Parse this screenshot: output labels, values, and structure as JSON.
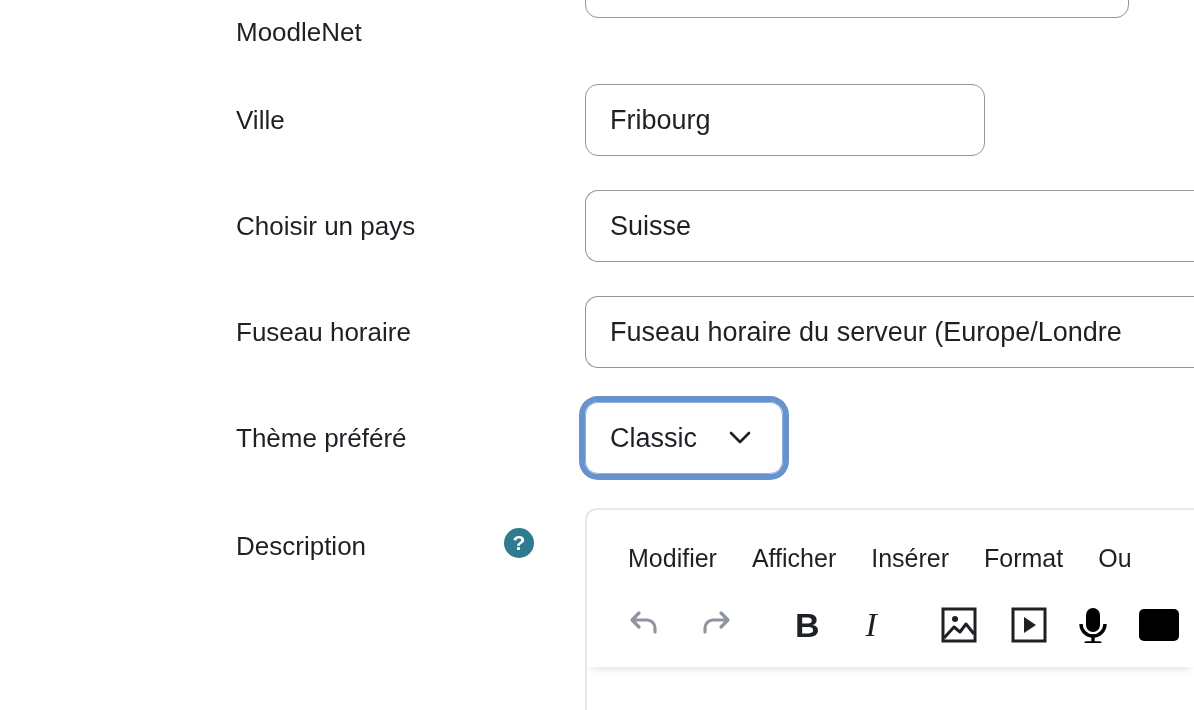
{
  "rows": [
    {
      "label": "MoodleNet",
      "field": {
        "kind": "text"
      }
    },
    {
      "label": "Ville",
      "field": {
        "kind": "text",
        "value": "Fribourg"
      }
    },
    {
      "label": "Choisir un pays",
      "field": {
        "kind": "select",
        "value": "Suisse"
      }
    },
    {
      "label": "Fuseau horaire",
      "field": {
        "kind": "select",
        "value": "Fuseau horaire du serveur (Europe/Londre"
      }
    },
    {
      "label": "Thème préféré",
      "field": {
        "kind": "dropdown",
        "value": "Classic",
        "focused": true
      }
    },
    {
      "label": "Description",
      "help": "?",
      "field": {
        "kind": "editor",
        "menu": [
          "Modifier",
          "Afficher",
          "Insérer",
          "Format",
          "Ou"
        ],
        "toolbar": [
          {
            "kind": "undo",
            "disabled": true
          },
          {
            "kind": "redo",
            "disabled": true
          },
          {
            "kind": "bold",
            "text": "B"
          },
          {
            "kind": "italic",
            "text": "I"
          },
          {
            "kind": "image",
            "disabled": false
          },
          {
            "kind": "media",
            "disabled": false
          },
          {
            "kind": "mic",
            "disabled": false
          },
          {
            "kind": "square",
            "disabled": false
          }
        ]
      }
    }
  ]
}
